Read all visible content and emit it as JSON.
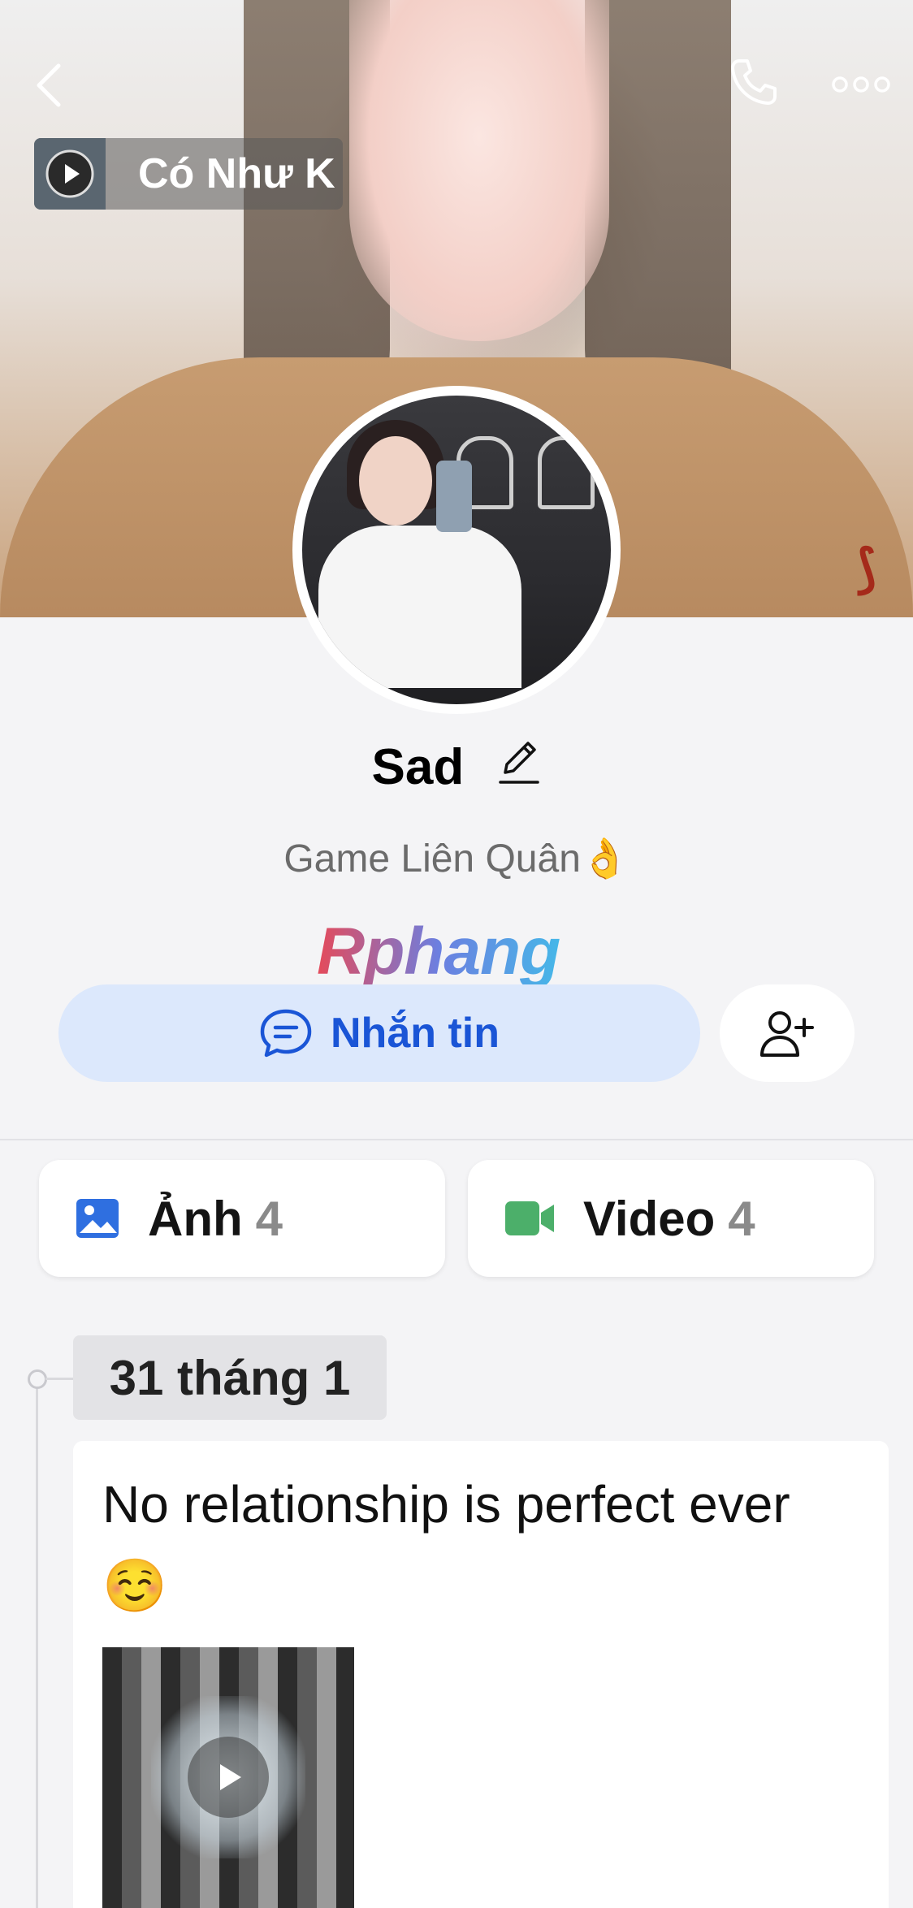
{
  "header": {
    "music_title": "Có Như K"
  },
  "profile": {
    "name": "Sad",
    "bio": "Game Liên Quân👌",
    "watermark": "Rphang"
  },
  "actions": {
    "message_label": "Nhắn tin"
  },
  "media": {
    "photos_label": "Ảnh",
    "photos_count": "4",
    "videos_label": "Video",
    "videos_count": "4"
  },
  "timeline": {
    "date": "31 tháng 1",
    "post_text": "No relationship is perfect ever☺️"
  },
  "colors": {
    "accent_blue": "#1a55d6",
    "message_bg": "#dce8fc",
    "video_icon_green": "#4caf6a",
    "photo_icon_blue": "#2f6fe0"
  },
  "icons": [
    "back-icon",
    "phone-icon",
    "more-icon",
    "play-icon",
    "edit-icon",
    "chat-icon",
    "add-friend-icon",
    "photo-icon",
    "video-icon"
  ]
}
